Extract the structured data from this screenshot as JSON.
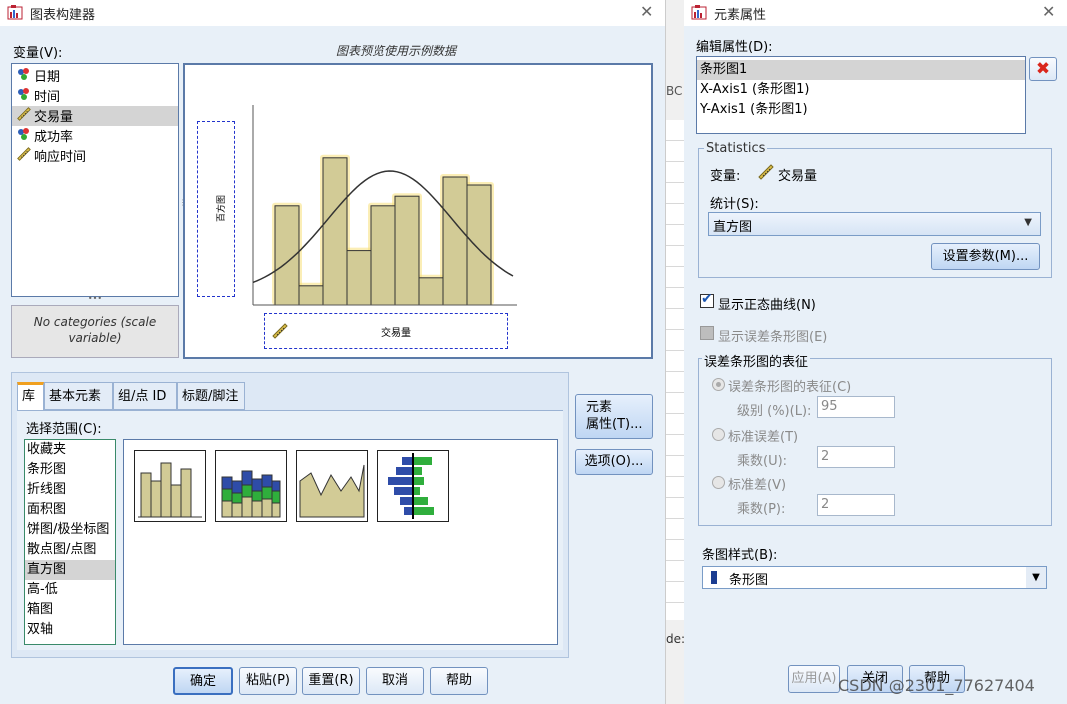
{
  "left_dialog": {
    "title": "图表构建器",
    "variables_label": "变量(V):",
    "variables": [
      {
        "label": "日期",
        "icon": "nominal-icon"
      },
      {
        "label": "时间",
        "icon": "nominal-icon"
      },
      {
        "label": "交易量",
        "icon": "scale-icon"
      },
      {
        "label": "成功率",
        "icon": "nominal-icon"
      },
      {
        "label": "响应时间",
        "icon": "scale-icon"
      }
    ],
    "selected_variable": "交易量",
    "categories_note": "No categories (scale variable)",
    "preview_title": "图表预览使用示例数据",
    "preview_y_label": "百方图",
    "preview_x_label": "交易量",
    "preview_bars": [
      0.62,
      0.12,
      0.92,
      0.34,
      0.62,
      0.68,
      0.17,
      0.8,
      0.75
    ],
    "tabs": [
      "库",
      "基本元素",
      "组/点 ID",
      "标题/脚注"
    ],
    "active_tab": "库",
    "choose_from_label": "选择范围(C):",
    "chart_types": [
      "收藏夹",
      "条形图",
      "折线图",
      "面积图",
      "饼图/极坐标图",
      "散点图/点图",
      "直方图",
      "高-低",
      "箱图",
      "双轴"
    ],
    "selected_chart_type": "直方图",
    "element_props_button": [
      "元素",
      "属性(T)..."
    ],
    "options_button": "选项(O)...",
    "buttons": {
      "ok": "确定",
      "paste": "粘贴(P)",
      "reset": "重置(R)",
      "cancel": "取消",
      "help": "帮助"
    }
  },
  "right_dialog": {
    "title": "元素属性",
    "edit_props_label": "编辑属性(D):",
    "props_items": [
      "条形图1",
      "X-Axis1 (条形图1)",
      "Y-Axis1 (条形图1)"
    ],
    "selected_prop": "条形图1",
    "statistics_legend": "Statistics",
    "variable_label": "变量:",
    "variable_value": "交易量",
    "stat_label": "统计(S):",
    "stat_value": "直方图",
    "set_params_button": "设置参数(M)...",
    "show_normal_curve": "显示正态曲线(N)",
    "show_normal_checked": true,
    "show_error_bars": "显示误差条形图(E)",
    "error_legend": "误差条形图的表征",
    "error_options": [
      {
        "label": "误差条形图的表征(C)",
        "sub_label": "级别 (%)(L):",
        "value": "95"
      },
      {
        "label": "标准误差(T)",
        "sub_label": "乘数(U):",
        "value": "2"
      },
      {
        "label": "标准差(V)",
        "sub_label": "乘数(P):",
        "value": "2"
      }
    ],
    "bar_style_label": "条图样式(B):",
    "bar_style_value": "条形图",
    "buttons": {
      "apply": "应用(A)",
      "close": "关闭",
      "help": "帮助"
    }
  },
  "middle_fragments": {
    "top": "BC",
    "bottom": "de:"
  },
  "watermark": "CSDN @2301_77627404",
  "colors": {
    "bar_fill": "#d2cb96",
    "bar_highlight": "#f8e07a",
    "accent_red": "#d9261c",
    "check_blue": "#1b55b0"
  }
}
